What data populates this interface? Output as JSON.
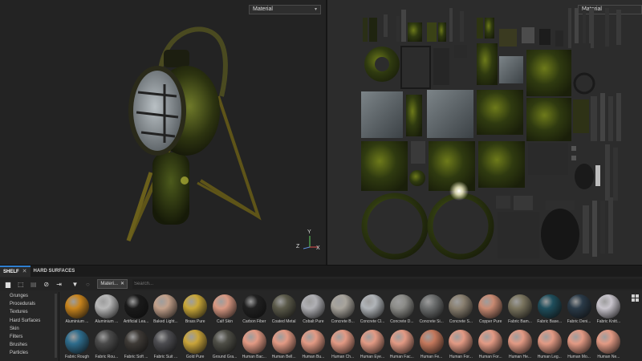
{
  "viewport3d": {
    "mode_label": "Material",
    "gizmo": {
      "y": "Y",
      "z": "Z",
      "x": "X"
    }
  },
  "viewport2d": {
    "mode_label": "Material"
  },
  "tabs": [
    {
      "label": "SHELF",
      "active": true
    },
    {
      "label": "HARD SURFACES",
      "active": false
    }
  ],
  "toolbar": {
    "icons": [
      "folder-icon",
      "new-resource-icon",
      "import-icon",
      "hide-icon",
      "export-icon",
      "filter-icon",
      "circle-icon"
    ],
    "filter_chip": "Materi...",
    "search_placeholder": "Search..."
  },
  "categories": [
    "Grunges",
    "Procedurals",
    "Textures",
    "Hard Surfaces",
    "Skin",
    "Filters",
    "Brushes",
    "Particles"
  ],
  "materials_row1": [
    {
      "label": "Aluminium ...",
      "color": "#c8841d"
    },
    {
      "label": "Aluminium ...",
      "color": "#b8b8b8"
    },
    {
      "label": "Artificial Lea...",
      "color": "#1a1a1a"
    },
    {
      "label": "Baked Light...",
      "color": "#c2a08a"
    },
    {
      "label": "Brass Pure",
      "color": "#c9a738"
    },
    {
      "label": "Calf Skin",
      "color": "#d89882"
    },
    {
      "label": "Carbon Fiber",
      "color": "#202020"
    },
    {
      "label": "Coated Metal",
      "color": "#5b5a4a"
    },
    {
      "label": "Cobalt Pure",
      "color": "#b0b0b4"
    },
    {
      "label": "Concrete B...",
      "color": "#a8a49c"
    },
    {
      "label": "Concrete Cl...",
      "color": "#b0b4b8"
    },
    {
      "label": "Concrete D...",
      "color": "#8c8c88"
    },
    {
      "label": "Concrete Si...",
      "color": "#6c6e6e"
    },
    {
      "label": "Concrete S...",
      "color": "#8a8070"
    },
    {
      "label": "Copper Pure",
      "color": "#c98a72"
    },
    {
      "label": "Fabric Bam...",
      "color": "#7a745e"
    },
    {
      "label": "Fabric Base...",
      "color": "#1f4e5c"
    },
    {
      "label": "Fabric Deni...",
      "color": "#2a3a48"
    },
    {
      "label": "Fabric Knitt...",
      "color": "#c8c4cc"
    }
  ],
  "materials_row2": [
    {
      "label": "Fabric Rough",
      "color": "#2e6c8c"
    },
    {
      "label": "Fabric Rou...",
      "color": "#4a4a4a"
    },
    {
      "label": "Fabric Soft ...",
      "color": "#3e3a36"
    },
    {
      "label": "Fabric Suit ...",
      "color": "#4c4c50"
    },
    {
      "label": "Gold Pure",
      "color": "#c9a43a"
    },
    {
      "label": "Ground Gra...",
      "color": "#4e4e46"
    },
    {
      "label": "Human Bac...",
      "color": "#e39a84"
    },
    {
      "label": "Human Bell...",
      "color": "#e39a84"
    },
    {
      "label": "Human Bu...",
      "color": "#e39a84"
    },
    {
      "label": "Human Ch...",
      "color": "#e39a84"
    },
    {
      "label": "Human Eye...",
      "color": "#e39a84"
    },
    {
      "label": "Human Fac...",
      "color": "#e39a84"
    },
    {
      "label": "Human Fe...",
      "color": "#c4785c"
    },
    {
      "label": "Human For...",
      "color": "#e39a84"
    },
    {
      "label": "Human For...",
      "color": "#e39a84"
    },
    {
      "label": "Human He...",
      "color": "#e39a84"
    },
    {
      "label": "Human Leg...",
      "color": "#e39a84"
    },
    {
      "label": "Human Mo...",
      "color": "#e39a84"
    },
    {
      "label": "Human Ne...",
      "color": "#e39a84"
    }
  ]
}
